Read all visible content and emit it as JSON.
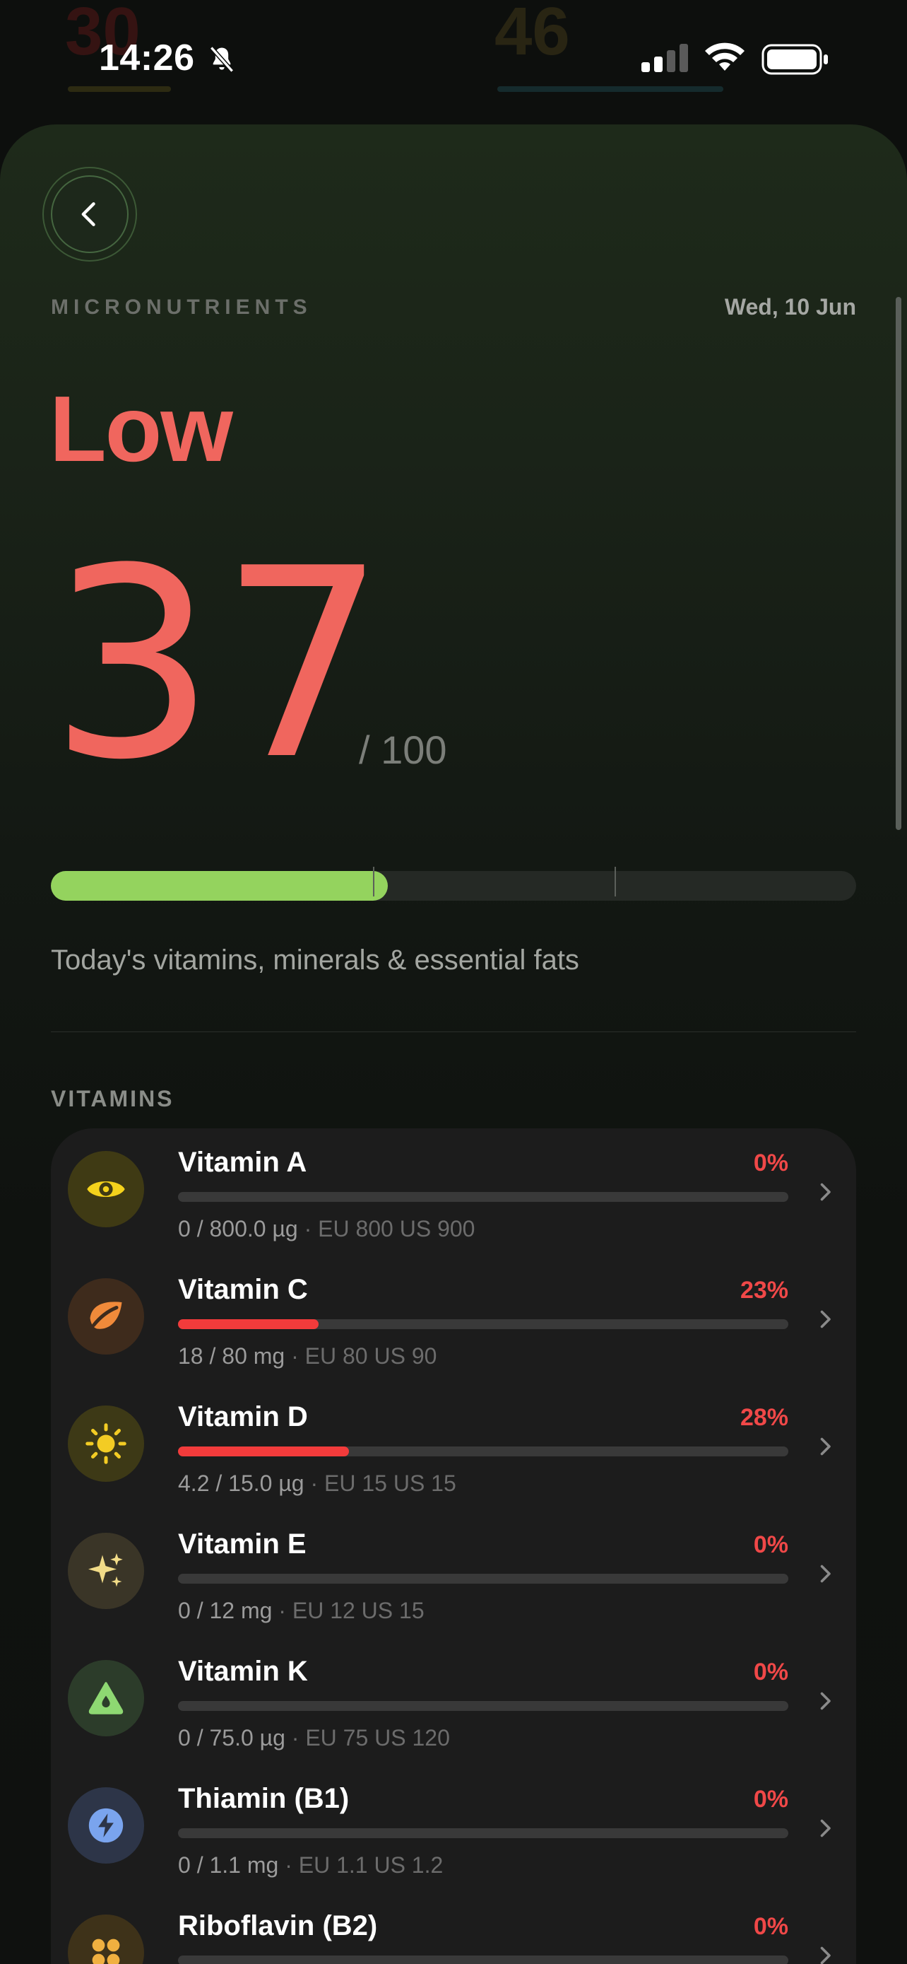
{
  "status_bar": {
    "time": "14:26",
    "ghost_left": "30",
    "ghost_right": "46"
  },
  "header": {
    "section_label": "MICRONUTRIENTS",
    "date": "Wed, 10 Jun"
  },
  "score": {
    "status": "Low",
    "value": "37",
    "max": "/ 100",
    "progress_fraction": 0.37
  },
  "subtitle": "Today's vitamins, minerals & essential fats",
  "vitamins": {
    "label": "VITAMINS",
    "items": [
      {
        "name": "Vitamin A",
        "percent": "0%",
        "fraction": 0.0,
        "amount": "0 / 800.0 µg",
        "reference": "EU 800 US 900",
        "icon": "eye-icon",
        "icon_bg": "#3f3a14",
        "icon_color": "#f4d21c"
      },
      {
        "name": "Vitamin C",
        "percent": "23%",
        "fraction": 0.23,
        "amount": "18 / 80 mg",
        "reference": "EU 80 US 90",
        "icon": "leaf-icon",
        "icon_bg": "#3e2b1c",
        "icon_color": "#f08a3a"
      },
      {
        "name": "Vitamin D",
        "percent": "28%",
        "fraction": 0.28,
        "amount": "4.2 / 15.0 µg",
        "reference": "EU 15 US 15",
        "icon": "sun-icon",
        "icon_bg": "#3d3916",
        "icon_color": "#f3cc24"
      },
      {
        "name": "Vitamin E",
        "percent": "0%",
        "fraction": 0.0,
        "amount": "0 / 12 mg",
        "reference": "EU 12 US 15",
        "icon": "sparkles-icon",
        "icon_bg": "#3a3527",
        "icon_color": "#f2dc88"
      },
      {
        "name": "Vitamin K",
        "percent": "0%",
        "fraction": 0.0,
        "amount": "0 / 75.0 µg",
        "reference": "EU 75 US 120",
        "icon": "triangle-drop-icon",
        "icon_bg": "#2c3c2a",
        "icon_color": "#8ed872"
      },
      {
        "name": "Thiamin (B1)",
        "percent": "0%",
        "fraction": 0.0,
        "amount": "0 / 1.1 mg",
        "reference": "EU 1.1 US 1.2",
        "icon": "bolt-icon",
        "icon_bg": "#2d3548",
        "icon_color": "#7aa4ee"
      },
      {
        "name": "Riboflavin (B2)",
        "percent": "0%",
        "fraction": 0.0,
        "amount": "",
        "reference": "",
        "icon": "dots-icon",
        "icon_bg": "#3e3219",
        "icon_color": "#f0b040"
      }
    ]
  }
}
